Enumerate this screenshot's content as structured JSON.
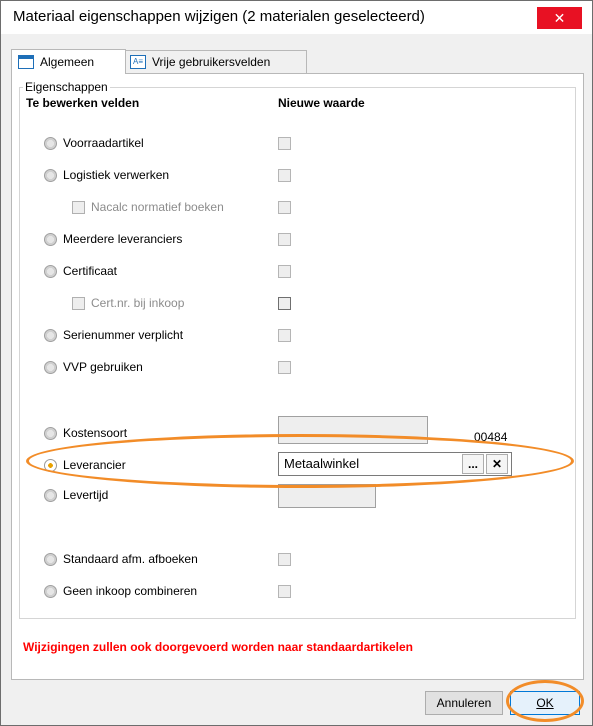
{
  "window": {
    "title": "Materiaal eigenschappen wijzigen (2 materialen geselecteerd)",
    "close_glyph": "✕"
  },
  "tabs": [
    {
      "label": "Algemeen",
      "icon": "form-icon",
      "active": true
    },
    {
      "label": "Vrije gebruikersvelden",
      "icon": "ab-field-icon",
      "active": false
    }
  ],
  "group": {
    "legend": "Eigenschappen"
  },
  "columns": {
    "fields": "Te bewerken velden",
    "value": "Nieuwe waarde"
  },
  "rows": {
    "voorraadartikel": "Voorraadartikel",
    "logistiek": "Logistiek verwerken",
    "nacalc": "Nacalc normatief boeken",
    "meerdere": "Meerdere leveranciers",
    "certificaat": "Certificaat",
    "certnr": "Cert.nr. bij inkoop",
    "serienummer": "Serienummer verplicht",
    "vvp": "VVP gebruiken",
    "kostensoort": "Kostensoort",
    "leverancier": "Leverancier",
    "levertijd": "Levertijd",
    "standaard": "Standaard afm. afboeken",
    "geen_inkoop": "Geen inkoop combineren"
  },
  "leverancier": {
    "value": "Metaalwinkel",
    "code": "00484",
    "browse_glyph": "...",
    "clear_glyph": "✕"
  },
  "warning": "Wijzigingen zullen ook doorgevoerd worden naar standaardartikelen",
  "buttons": {
    "cancel": "Annuleren",
    "ok": "OK"
  },
  "colors": {
    "highlight": "#f28c28",
    "warning": "#ff0000",
    "close": "#e81123"
  }
}
